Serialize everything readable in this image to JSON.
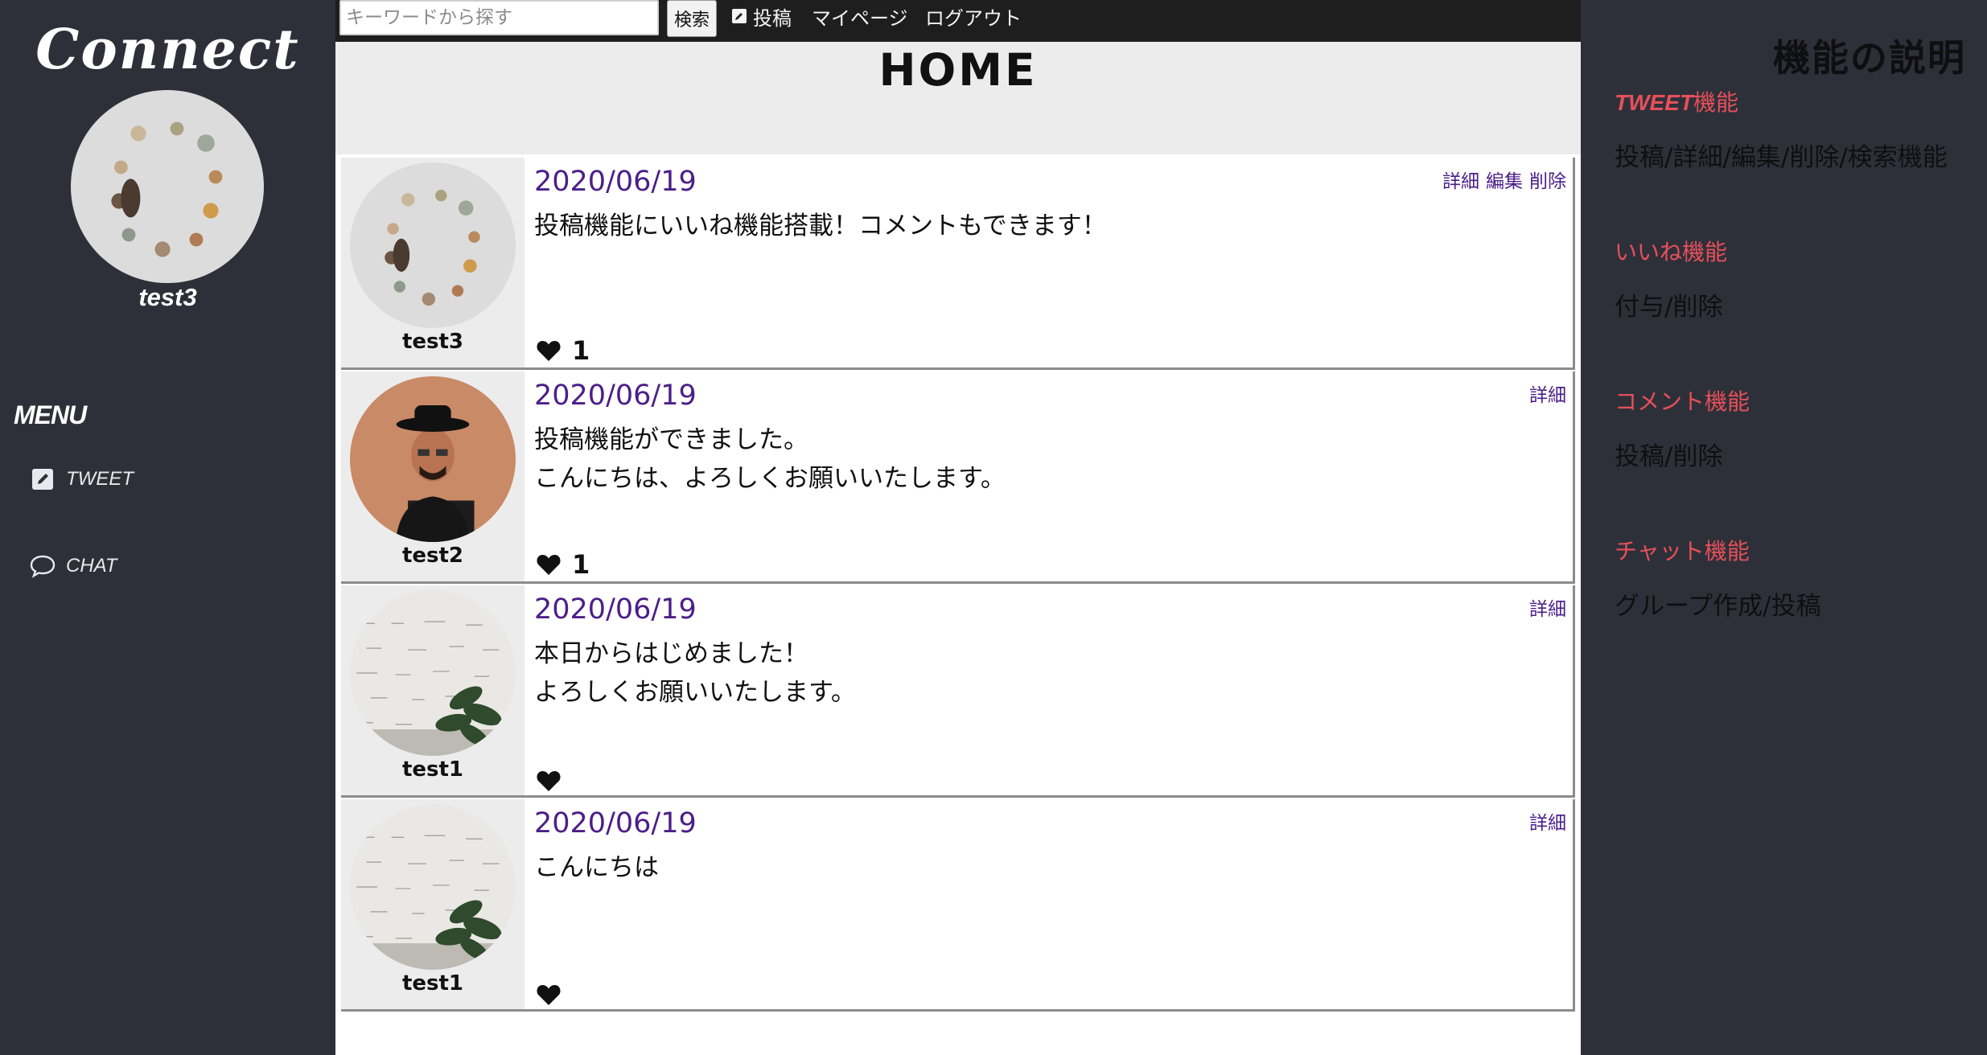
{
  "app": {
    "logo": "Connect",
    "user_name": "test3"
  },
  "menu": {
    "heading": "MENU",
    "items": [
      {
        "label": "TWEET",
        "icon": "edit-icon"
      },
      {
        "label": "CHAT",
        "icon": "chat-bubble-icon"
      }
    ]
  },
  "topbar": {
    "search_placeholder": "キーワードから探す",
    "search_value": "",
    "search_button": "検索",
    "post_label": "投稿",
    "mypage_label": "マイページ",
    "logout_label": "ログアウト"
  },
  "page": {
    "title": "HOME"
  },
  "posts": [
    {
      "user": "test3",
      "date": "2020/06/19",
      "lines": [
        "投稿機能にいいね機能搭載！コメントもできます！"
      ],
      "actions": [
        "詳細",
        "編集",
        "削除"
      ],
      "likes": "1"
    },
    {
      "user": "test2",
      "date": "2020/06/19",
      "lines": [
        "投稿機能ができました。",
        "こんにちは、よろしくお願いいたします。"
      ],
      "actions": [
        "詳細"
      ],
      "likes": "1"
    },
    {
      "user": "test1",
      "date": "2020/06/19",
      "lines": [
        "本日からはじめました！",
        "よろしくお願いいたします。"
      ],
      "actions": [
        "詳細"
      ],
      "likes": ""
    },
    {
      "user": "test1",
      "date": "2020/06/19",
      "lines": [
        "こんにちは"
      ],
      "actions": [
        "詳細"
      ],
      "likes": ""
    }
  ],
  "features": {
    "title": "機能の説明",
    "items": [
      {
        "heading_latin": "TWEET",
        "heading": "機能",
        "desc": "投稿/詳細/編集/削除/検索機能"
      },
      {
        "heading_latin": "",
        "heading": "いいね機能",
        "desc": "付与/削除"
      },
      {
        "heading_latin": "",
        "heading": "コメント機能",
        "desc": "投稿/削除"
      },
      {
        "heading_latin": "",
        "heading": "チャット機能",
        "desc": "グループ作成/投稿"
      }
    ]
  },
  "colors": {
    "sidebar_bg": "#2e3039",
    "topbar_bg": "#1e1e1e",
    "date_purple": "#4b1f88",
    "feature_heading_red": "#e6505a"
  }
}
